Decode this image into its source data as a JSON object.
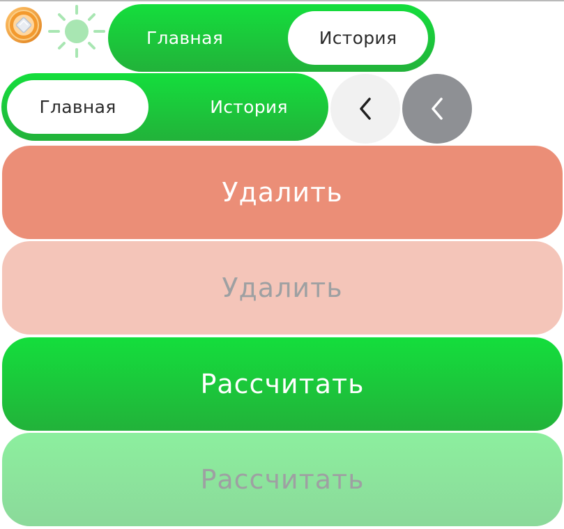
{
  "colors": {
    "green": "#14de3c",
    "green_dark": "#22b23a",
    "green_disabled": "#8cef9e",
    "red": "#eb8e77",
    "red_disabled": "#f4c5b9",
    "back_light": "#f1f1f1",
    "back_dark": "#8e9094"
  },
  "icons": {
    "coin": "coin-icon",
    "sun": "sun-icon",
    "back": "chevron-left-icon"
  },
  "toggle_a": {
    "main_label": "Главная",
    "history_label": "История",
    "selected": "История"
  },
  "toggle_b": {
    "main_label": "Главная",
    "history_label": "История",
    "selected": "Главная"
  },
  "buttons": {
    "delete_label": "Удалить",
    "delete_disabled_label": "Удалить",
    "calculate_label": "Рассчитать",
    "calculate_disabled_label": "Рассчитать"
  }
}
